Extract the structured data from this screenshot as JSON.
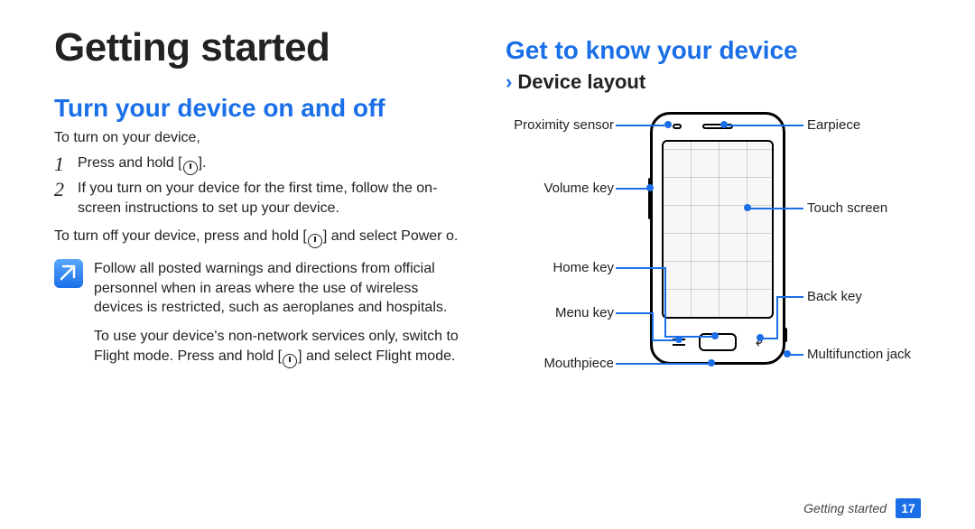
{
  "page": {
    "chapter_title": "Getting started",
    "footer_label": "Getting started",
    "page_number": "17"
  },
  "left": {
    "h_turn": "Turn your device on and off",
    "intro_on": "To turn on your device,",
    "step1": "Press and hold [",
    "step1_tail": "].",
    "step2": "If you turn on your device for the first time, follow the on-screen instructions to set up your device.",
    "intro_off_a": "To turn off your device, press and hold [",
    "intro_off_b": "] and select ",
    "power_off_label": "Power o",
    "intro_off_c": ".",
    "note1": "Follow all posted warnings and directions from official personnel when in areas where the use of wireless devices is restricted, such as aeroplanes and hospitals.",
    "note2_a": "To use your device's non-network services only, switch to Flight mode. Press and hold [",
    "note2_b": "] and select ",
    "flight_mode_label": "Flight mode",
    "note2_c": "."
  },
  "right": {
    "h_know": "Get to know your device",
    "h_layout": "Device layout",
    "labels": {
      "proximity": "Proximity sensor",
      "volume": "Volume key",
      "home": "Home key",
      "menu": "Menu key",
      "mouthpiece": "Mouthpiece",
      "earpiece": "Earpiece",
      "touch": "Touch screen",
      "back": "Back key",
      "multijack": "Multifunction jack"
    }
  }
}
